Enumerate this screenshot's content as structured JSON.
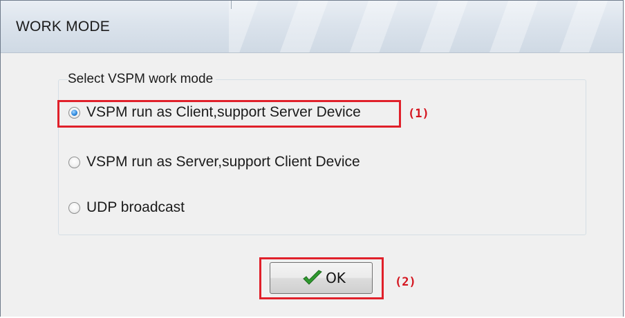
{
  "window": {
    "title": "WORK MODE"
  },
  "group": {
    "label": "Select VSPM work mode",
    "options": [
      {
        "label": "VSPM run as Client,support Server Device",
        "selected": true
      },
      {
        "label": "VSPM run as Server,support Client Device",
        "selected": false
      },
      {
        "label": "UDP broadcast",
        "selected": false
      }
    ]
  },
  "buttons": {
    "ok_label": "OK",
    "ok_icon": "check-icon"
  },
  "annotations": {
    "first": "(1)",
    "second": "(2)",
    "color": "#e0202a"
  }
}
